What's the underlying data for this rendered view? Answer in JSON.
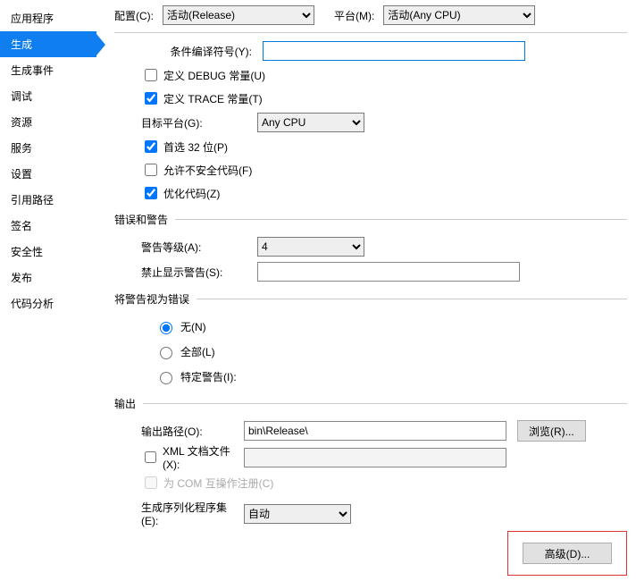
{
  "sidebar": {
    "items": [
      {
        "label": "应用程序",
        "active": false
      },
      {
        "label": "生成",
        "active": true
      },
      {
        "label": "生成事件",
        "active": false
      },
      {
        "label": "调试",
        "active": false
      },
      {
        "label": "资源",
        "active": false
      },
      {
        "label": "服务",
        "active": false
      },
      {
        "label": "设置",
        "active": false
      },
      {
        "label": "引用路径",
        "active": false
      },
      {
        "label": "签名",
        "active": false
      },
      {
        "label": "安全性",
        "active": false
      },
      {
        "label": "发布",
        "active": false
      },
      {
        "label": "代码分析",
        "active": false
      }
    ]
  },
  "topbar": {
    "config_label": "配置(C):",
    "config_value": "活动(Release)",
    "platform_label": "平台(M):",
    "platform_value": "活动(Any CPU)"
  },
  "general": {
    "cond_symbols_label": "条件编译符号(Y):",
    "cond_symbols_value": "",
    "define_debug_label": "定义 DEBUG 常量(U)",
    "define_debug_checked": false,
    "define_trace_label": "定义 TRACE 常量(T)",
    "define_trace_checked": true,
    "target_platform_label": "目标平台(G):",
    "target_platform_value": "Any CPU",
    "prefer32_label": "首选 32 位(P)",
    "prefer32_checked": true,
    "unsafe_label": "允许不安全代码(F)",
    "unsafe_checked": false,
    "optimize_label": "优化代码(Z)",
    "optimize_checked": true
  },
  "errors_section": {
    "title": "错误和警告",
    "warning_level_label": "警告等级(A):",
    "warning_level_value": "4",
    "suppress_label": "禁止显示警告(S):",
    "suppress_value": ""
  },
  "treat_section": {
    "title": "将警告视为错误",
    "none_label": "无(N)",
    "all_label": "全部(L)",
    "specific_label": "特定警告(I):",
    "selected": "none",
    "specific_value": ""
  },
  "output_section": {
    "title": "输出",
    "path_label": "输出路径(O):",
    "path_value": "bin\\Release\\",
    "browse_label": "浏览(R)...",
    "xml_label": "XML 文档文件(X):",
    "xml_checked": false,
    "xml_value": "",
    "com_label": "为 COM 互操作注册(C)",
    "com_checked": false,
    "serialization_label": "生成序列化程序集(E):",
    "serialization_value": "自动"
  },
  "advanced_label": "高级(D)..."
}
